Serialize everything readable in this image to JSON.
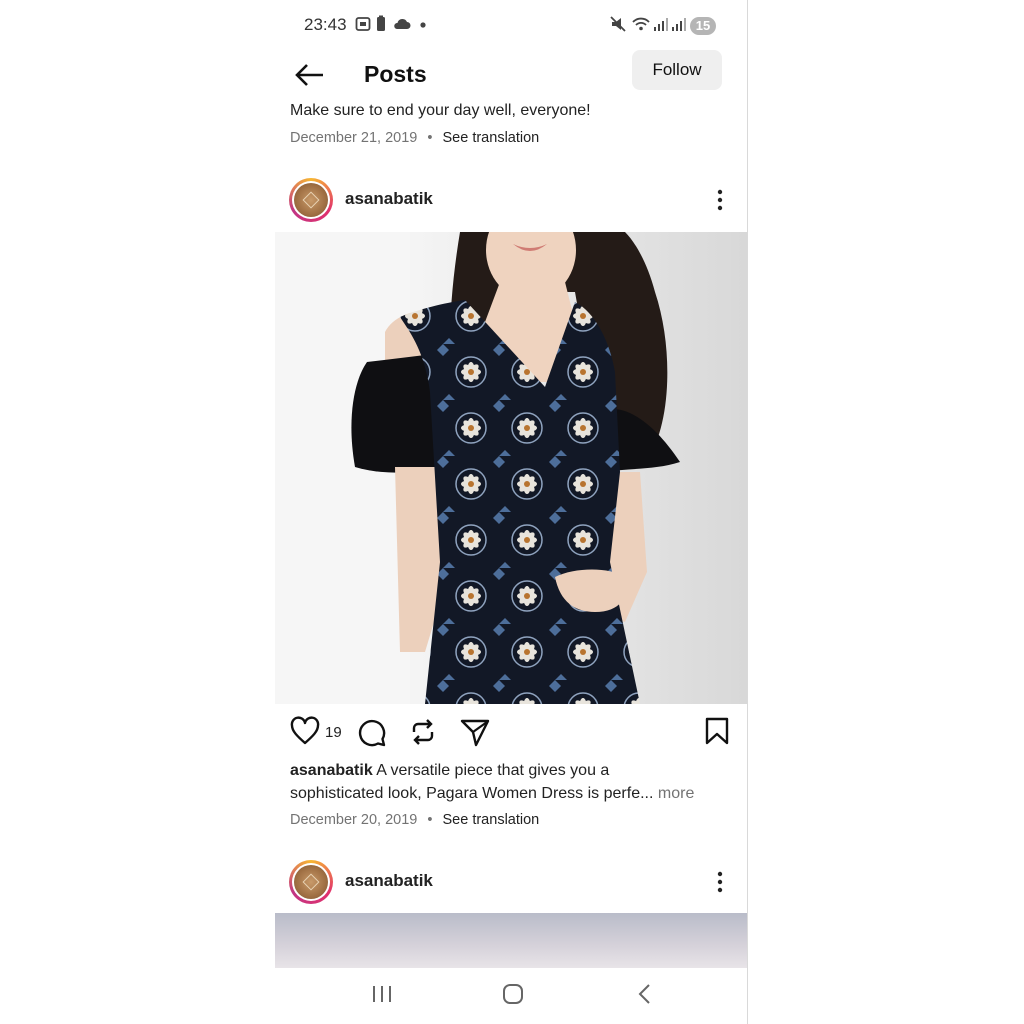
{
  "status_bar": {
    "time": "23:43",
    "battery_badge": "15",
    "icons": [
      "screenshot-icon",
      "battery-saver-icon",
      "cloud-icon",
      "dot-icon",
      "mute-icon",
      "wifi-icon",
      "signal-icon",
      "signal-icon"
    ]
  },
  "header": {
    "title": "Posts",
    "follow_label": "Follow"
  },
  "prev_post": {
    "caption": "Make sure to end your day well, everyone!",
    "date": "December 21, 2019",
    "separator": "•",
    "translate_label": "See translation"
  },
  "post": {
    "username": "asanabatik",
    "like_count": "19",
    "caption_user": "asanabatik",
    "caption_line1": "A versatile piece that gives you a",
    "caption_line2": "sophisticated look, Pagara Women Dress is perfe...",
    "more_label": "more",
    "date": "December 20, 2019",
    "separator": "•",
    "translate_label": "See translation"
  },
  "next_post": {
    "username": "asanabatik"
  },
  "colors": {
    "follow_bg": "#efefef",
    "meta_text": "#737373",
    "avatar_ring": "#e1306c"
  }
}
